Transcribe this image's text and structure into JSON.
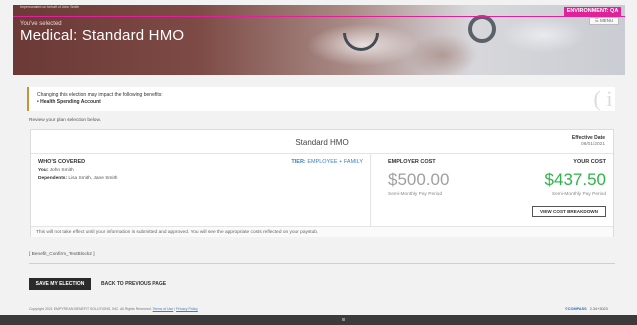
{
  "header": {
    "on_behalf": "Impersonated on behalf of John Smith",
    "subtitle": "You've selected",
    "title": "Medical: Standard HMO",
    "environment": "ENVIRONMENT: QA",
    "menu_label": "☰ MENU",
    "env_color": "#e0229a"
  },
  "notice": {
    "title": "Changing this election may impact the following benefits:",
    "items": [
      "Health Spending Account"
    ],
    "icon": "info-icon"
  },
  "review_text": "Review your plan selection below.",
  "plan": {
    "name": "Standard HMO",
    "effective_label": "Effective Date",
    "effective_date": "08/01/2021",
    "who_covered_label": "WHO'S COVERED",
    "tier_label": "TIER:",
    "tier_value": "EMPLOYEE + FAMILY",
    "you_label": "You:",
    "you_value": "John Smith",
    "dependents_label": "Dependents:",
    "dependents_value": "Lisa Smith, Jane Smith",
    "employer_cost_label": "EMPLOYER COST",
    "employer_cost": "$500.00",
    "employer_period": "Semi-Monthly Pay Period",
    "your_cost_label": "YOUR COST",
    "your_cost": "$437.50",
    "your_period": "Semi-Monthly Pay Period",
    "breakdown_button": "VIEW COST BREAKDOWN",
    "footnote": "This will not take effect until your information is submitted and approved. You will see the appropriate costs reflected on your paystub.",
    "your_cost_color": "#2fb34a",
    "tier_color": "#3b7fc4"
  },
  "textblock": "[ Benefit_Confirm_TextBlock2 ]",
  "actions": {
    "save": "SAVE MY ELECTION",
    "back": "BACK TO PREVIOUS PAGE"
  },
  "footer": {
    "copyright": "Copyright 2021 EMPYREAN BENEFIT SOLUTIONS, INC. All Rights Reserved.",
    "terms": "Terms of Use",
    "privacy": "Privacy Policy",
    "brand": "©COMPASS",
    "version": "2.34+3023"
  }
}
